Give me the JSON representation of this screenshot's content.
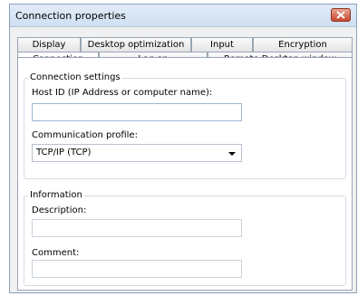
{
  "window": {
    "title": "Connection properties"
  },
  "tabs": {
    "row_back": [
      "Display",
      "Desktop optimization",
      "Input",
      "Encryption"
    ],
    "row_front": [
      "Connection",
      "Log on",
      "Remote Desktop window"
    ]
  },
  "connection_settings": {
    "legend": "Connection settings",
    "host_label": "Host ID (IP Address or computer name):",
    "host_value": "",
    "profile_label": "Communication profile:",
    "profile_value": "TCP/IP (TCP)"
  },
  "information": {
    "legend": "Information",
    "description_label": "Description:",
    "description_value": "",
    "comment_label": "Comment:",
    "comment_value": ""
  },
  "icons": {
    "close": "close-icon",
    "dropdown": "chevron-down-icon"
  }
}
